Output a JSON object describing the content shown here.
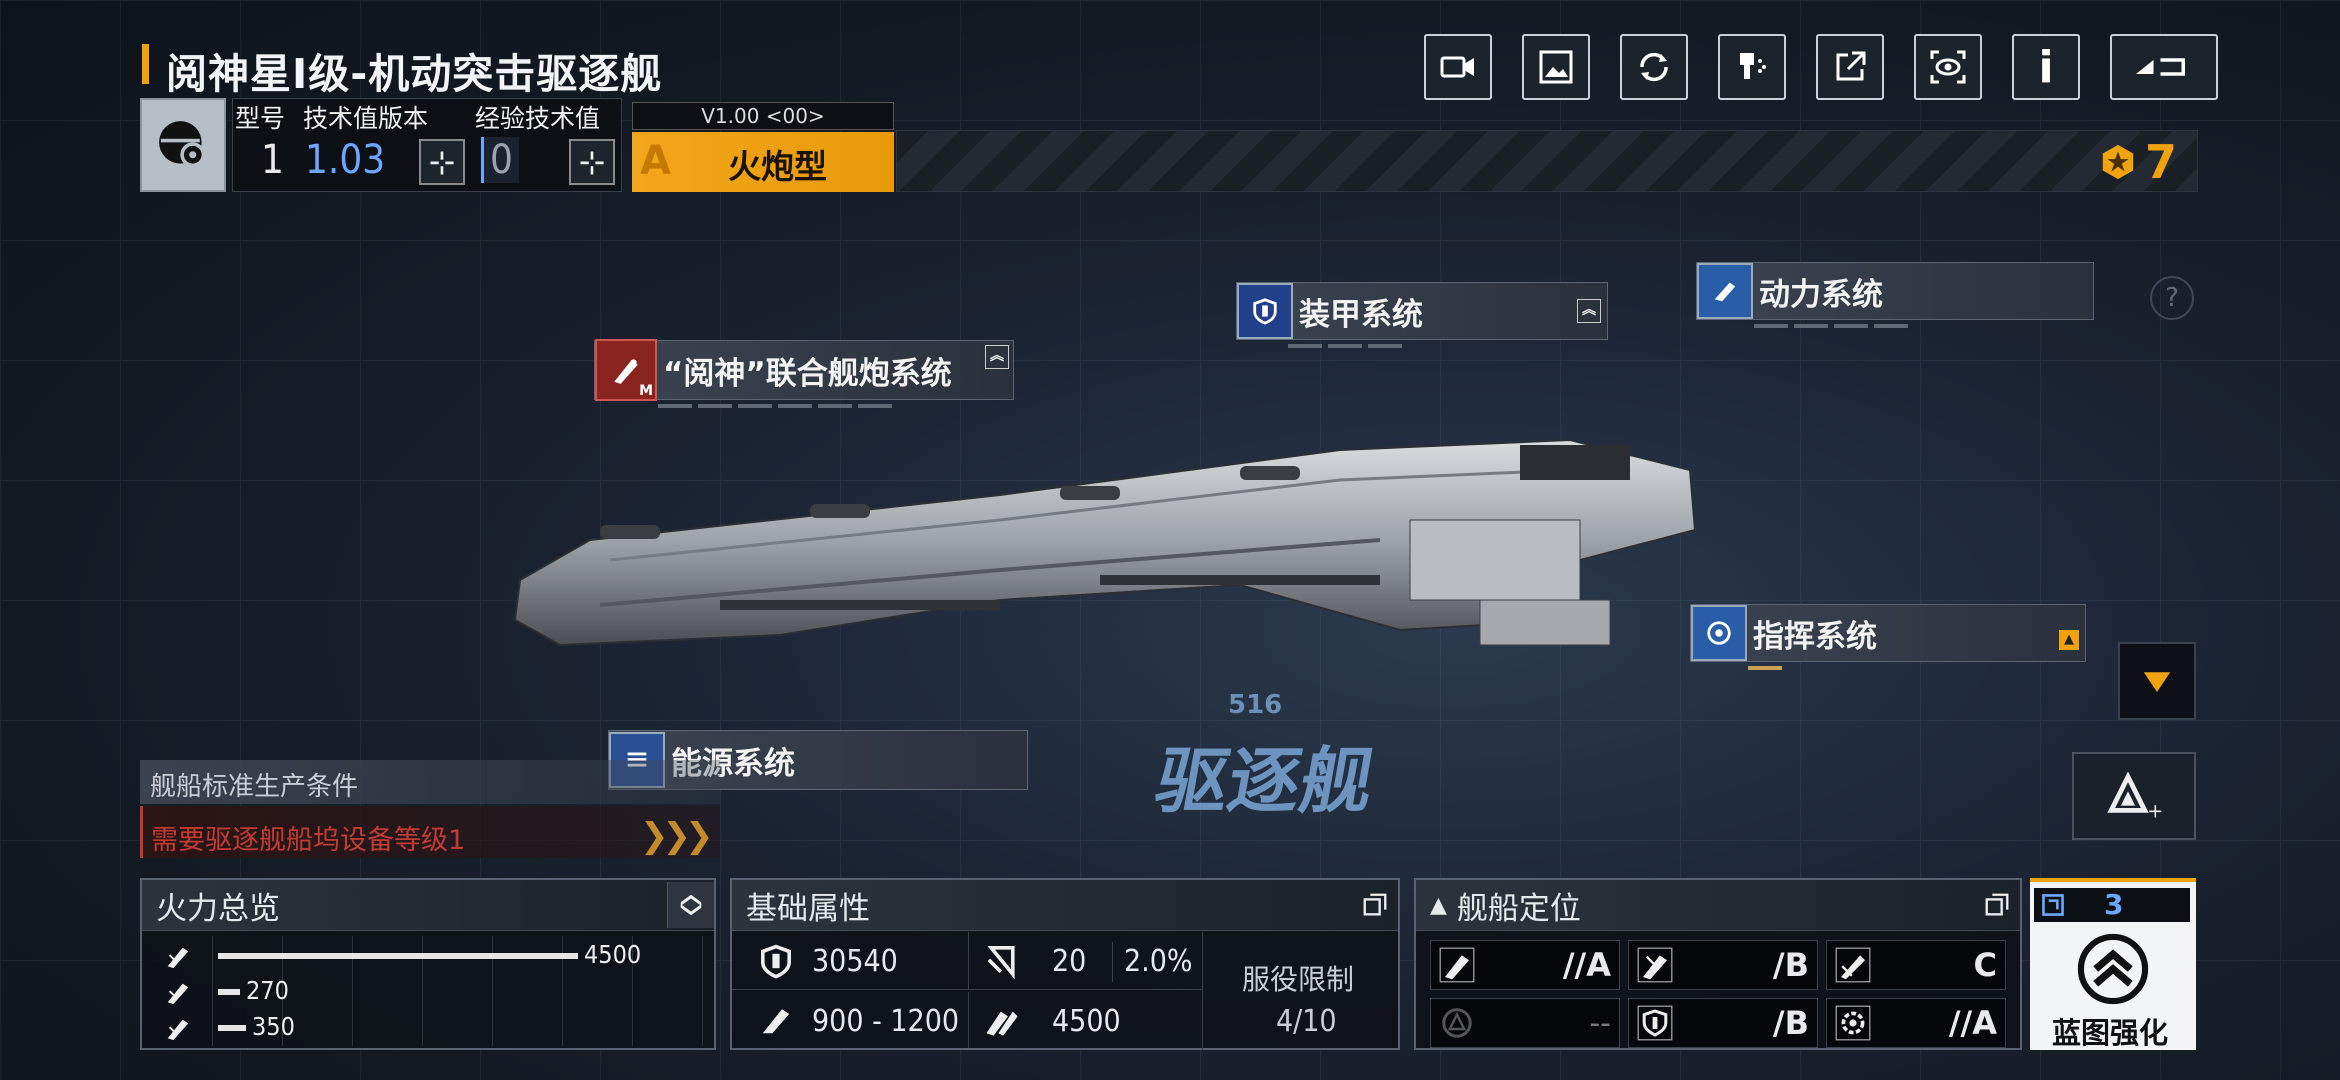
{
  "header": {
    "title": "阅神星I级-机动突击驱逐舰",
    "icons": [
      "video-icon",
      "screenshot-icon",
      "refresh-icon",
      "paint-icon",
      "share-icon",
      "view-icon",
      "info-icon",
      "back-icon"
    ],
    "info_icon_text": "i"
  },
  "ship_info": {
    "model_label": "型号",
    "model_value": "1",
    "tech_label": "技术值版本",
    "tech_value": "1.03",
    "exp_label": "经验技术值",
    "exp_value": "0",
    "version": "V1.00 <00>",
    "type_grade": "A",
    "type_name": "火炮型",
    "currency_value": "7"
  },
  "systems": {
    "armor": "装甲系统",
    "power": "动力系统",
    "weapon": "“阅神”联合舰炮系统",
    "weapon_badge": "M",
    "command": "指挥系统",
    "energy": "能源系统"
  },
  "class_emblem": {
    "number": "516",
    "name": "驱逐舰"
  },
  "production": {
    "title": "舰船标准生产条件",
    "requirement": "需要驱逐舰船坞设备等级1"
  },
  "firepower": {
    "title": "火力总览",
    "rows": [
      {
        "value": 4500,
        "label": "4500"
      },
      {
        "value": 270,
        "label": "270"
      },
      {
        "value": 350,
        "label": "350"
      }
    ],
    "max": 4500
  },
  "base_attrs": {
    "title": "基础属性",
    "hp": "30540",
    "armor": "20",
    "armor_pct": "2.0%",
    "speed": "900 - 1200",
    "power": "4500",
    "service_label": "服役限制",
    "service_value": "4/10"
  },
  "positioning": {
    "title": "舰船定位",
    "cells": [
      {
        "grade": "//A"
      },
      {
        "grade": "/B"
      },
      {
        "grade": "C"
      },
      {
        "grade": "--"
      },
      {
        "grade": "/B"
      },
      {
        "grade": "//A"
      }
    ]
  },
  "blueprint": {
    "count": "3",
    "label": "蓝图强化"
  },
  "colors": {
    "accent_orange": "#f0a20f",
    "accent_blue": "#6aa8ff",
    "warning_red": "#c23a34"
  }
}
